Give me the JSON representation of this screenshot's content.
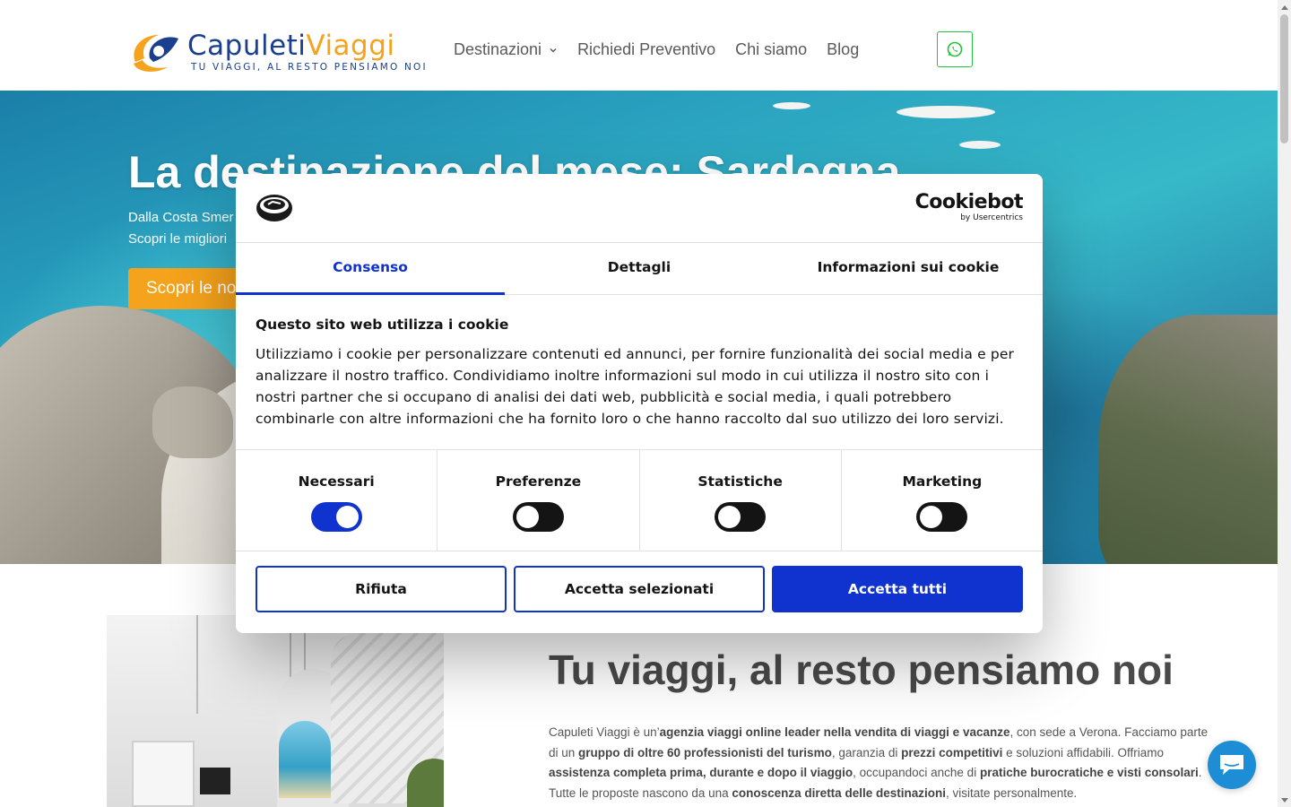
{
  "brand": {
    "name_part1": "Capuleti",
    "name_part2": "Viaggi",
    "tagline": "TU VIAGGI, AL RESTO PENSIAMO NOI"
  },
  "nav": {
    "items": [
      {
        "label": "Destinazioni",
        "has_dropdown": true
      },
      {
        "label": "Richiedi Preventivo",
        "has_dropdown": false
      },
      {
        "label": "Chi siamo",
        "has_dropdown": false
      },
      {
        "label": "Blog",
        "has_dropdown": false
      }
    ],
    "whatsapp_icon": "whatsapp-icon"
  },
  "hero": {
    "title": "La destinazione del mese: Sardegna",
    "subtitle_line1": "Dalla Costa Smer",
    "subtitle_line2": "Scopri le migliori",
    "cta_label": "Scopri le no"
  },
  "about": {
    "title": "Tu viaggi, al resto pensiamo noi",
    "text": [
      {
        "t": "Capuleti Viaggi è un’",
        "b": false
      },
      {
        "t": "agenzia viaggi online leader nella vendita di viaggi e vacanze",
        "b": true
      },
      {
        "t": ", con sede a Verona. Facciamo parte di un ",
        "b": false
      },
      {
        "t": "gruppo di oltre 60 professionisti del turismo",
        "b": true
      },
      {
        "t": ", garanzia di ",
        "b": false
      },
      {
        "t": "prezzi competitivi",
        "b": true
      },
      {
        "t": " e soluzioni affidabili. Offriamo ",
        "b": false
      },
      {
        "t": "assistenza completa prima, durante e dopo il viaggio",
        "b": true
      },
      {
        "t": ", occupandoci anche di ",
        "b": false
      },
      {
        "t": "pratiche burocratiche e visti consolari",
        "b": true
      },
      {
        "t": ". Tutte le proposte nascono da una ",
        "b": false
      },
      {
        "t": "conoscenza diretta delle destinazioni",
        "b": true
      },
      {
        "t": ", visitate personalmente.",
        "b": false
      }
    ]
  },
  "chat": {
    "icon": "chat-icon"
  },
  "cookie_dialog": {
    "brand_name": "Cookiebot",
    "brand_sub": "by Usercentrics",
    "tabs": [
      {
        "label": "Consenso",
        "active": true
      },
      {
        "label": "Dettagli",
        "active": false
      },
      {
        "label": "Informazioni sui cookie",
        "active": false
      }
    ],
    "heading": "Questo sito web utilizza i cookie",
    "body": "Utilizziamo i cookie per personalizzare contenuti ed annunci, per fornire funzionalità dei social media e per analizzare il nostro traffico. Condividiamo inoltre informazioni sul modo in cui utilizza il nostro sito con i nostri partner che si occupano di analisi dei dati web, pubblicità e social media, i quali potrebbero combinarle con altre informazioni che ha fornito loro o che hanno raccolto dal suo utilizzo dei loro servizi.",
    "toggles": [
      {
        "label": "Necessari",
        "on": true
      },
      {
        "label": "Preferenze",
        "on": false
      },
      {
        "label": "Statistiche",
        "on": false
      },
      {
        "label": "Marketing",
        "on": false
      }
    ],
    "buttons": {
      "reject": "Rifiuta",
      "accept_selected": "Accetta selezionati",
      "accept_all": "Accetta tutti"
    }
  },
  "colors": {
    "brand_blue": "#1a3f8f",
    "brand_orange": "#f5a21c",
    "cookiebot_blue": "#1032cf",
    "whatsapp_green": "#25c23d",
    "chat_blue": "#1d8ed6"
  }
}
